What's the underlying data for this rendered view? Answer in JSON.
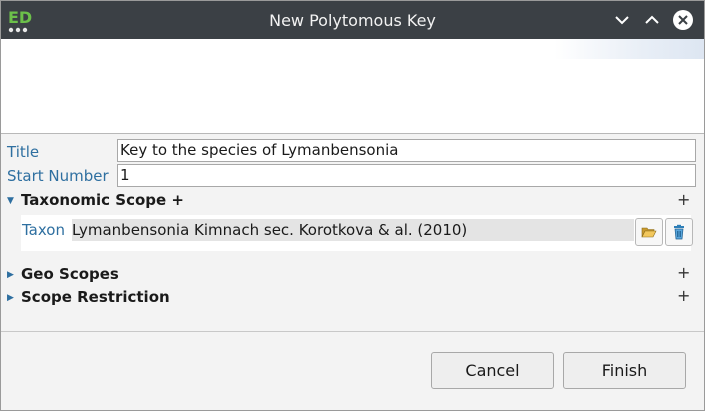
{
  "window": {
    "title": "New Polytomous Key",
    "app_icon": "ed-logo-icon",
    "controls": [
      "minimize-icon",
      "maximize-icon",
      "close-icon"
    ]
  },
  "form": {
    "title_label": "Title",
    "title_value": "Key to the species of Lymanbensonia",
    "start_number_label": "Start Number",
    "start_number_value": "1"
  },
  "sections": {
    "taxonomic_scope": {
      "label": "Taxonomic Scope +",
      "expanded": true,
      "taxon_label": "Taxon",
      "taxon_value": "Lymanbensonia Kimnach sec. Korotkova & al. (2010)",
      "buttons": [
        "open-folder-icon",
        "trash-icon"
      ]
    },
    "geo_scopes": {
      "label": "Geo Scopes",
      "expanded": false
    },
    "scope_restriction": {
      "label": "Scope Restriction",
      "expanded": false
    },
    "add_symbol": "+"
  },
  "buttons": {
    "cancel": "Cancel",
    "finish": "Finish"
  },
  "colors": {
    "titlebar": "#3b4045",
    "label_blue": "#2e6fa0",
    "logo_green": "#6cc04a"
  }
}
